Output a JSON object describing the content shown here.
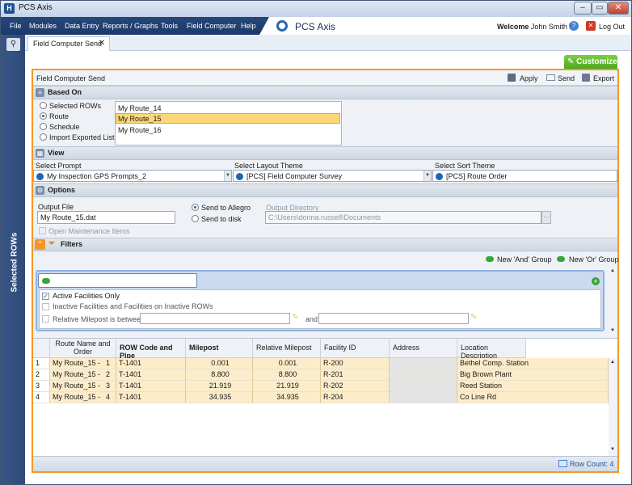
{
  "window": {
    "title": "PCS Axis",
    "logo_letter": "H"
  },
  "menu": [
    "File",
    "Modules",
    "Data Entry",
    "Reports / Graphs",
    "Tools",
    "Field Computer",
    "Help"
  ],
  "brand": "PCS Axis",
  "header": {
    "welcome": "Welcome",
    "user": "John Smith",
    "logout": "Log Out"
  },
  "sidebar": {
    "label": "Selected ROWs"
  },
  "tab": {
    "label": "Field Computer Send"
  },
  "customize_label": "Customize",
  "panel": {
    "title": "Field Computer Send",
    "apply": "Apply",
    "send": "Send",
    "export": "Export"
  },
  "based_on": {
    "title": "Based On",
    "options": [
      "Selected ROWs",
      "Route",
      "Schedule",
      "Import Exported List"
    ],
    "selected": "Route",
    "routes": [
      "My Route_14",
      "My Route_15",
      "My Route_16"
    ],
    "selected_route": "My Route_15"
  },
  "view": {
    "title": "View",
    "prompt_label": "Select Prompt",
    "prompt_value": "My Inspection GPS Prompts_2",
    "layout_label": "Select Layout Theme",
    "layout_value": "[PCS] Field Computer Survey",
    "sort_label": "Select Sort Theme",
    "sort_value": "[PCS] Route Order"
  },
  "options": {
    "title": "Options",
    "output_file_label": "Output File",
    "output_file_value": "My Route_15.dat",
    "send_allegro": "Send to Allegro",
    "send_disk": "Send to disk",
    "output_dir_label": "Output Directory",
    "output_dir_value": "C:\\Users\\donna.russell\\Documents",
    "open_maint": "Open Maintenance Items"
  },
  "filters": {
    "title": "Filters",
    "new_and": "New 'And' Group",
    "new_or": "New 'Or' Group",
    "active_only": "Active Facilities Only",
    "inactive": "Inactive Facilities and Facilities on Inactive ROWs",
    "relative_mp": "Relative Milepost is between",
    "and_label": "and"
  },
  "table": {
    "headers": [
      "Route Name and Order",
      "ROW Code and Pipe",
      "Milepost",
      "Relative Milepost",
      "Facility ID",
      "Address",
      "Location Description"
    ],
    "rows": [
      {
        "n": "1",
        "route": "My Route_15 -",
        "order": "1",
        "row": "T-1401",
        "mp": "0.001",
        "rmp": "0.001",
        "fid": "R-200",
        "addr": "",
        "loc": "Bethel Comp. Station"
      },
      {
        "n": "2",
        "route": "My Route_15 -",
        "order": "2",
        "row": "T-1401",
        "mp": "8.800",
        "rmp": "8.800",
        "fid": "R-201",
        "addr": "",
        "loc": "Big Brown Plant"
      },
      {
        "n": "3",
        "route": "My Route_15 -",
        "order": "3",
        "row": "T-1401",
        "mp": "21.919",
        "rmp": "21.919",
        "fid": "R-202",
        "addr": "",
        "loc": "Reed Station"
      },
      {
        "n": "4",
        "route": "My Route_15 -",
        "order": "4",
        "row": "T-1401",
        "mp": "34.935",
        "rmp": "34.935",
        "fid": "R-204",
        "addr": "",
        "loc": "Co Line Rd"
      }
    ],
    "row_count": "Row Count: 4"
  },
  "colors": {
    "accent": "#f3972a",
    "menu": "#1f3f70",
    "selected_row": "#fbd777",
    "grid_row": "#fcecc9"
  }
}
